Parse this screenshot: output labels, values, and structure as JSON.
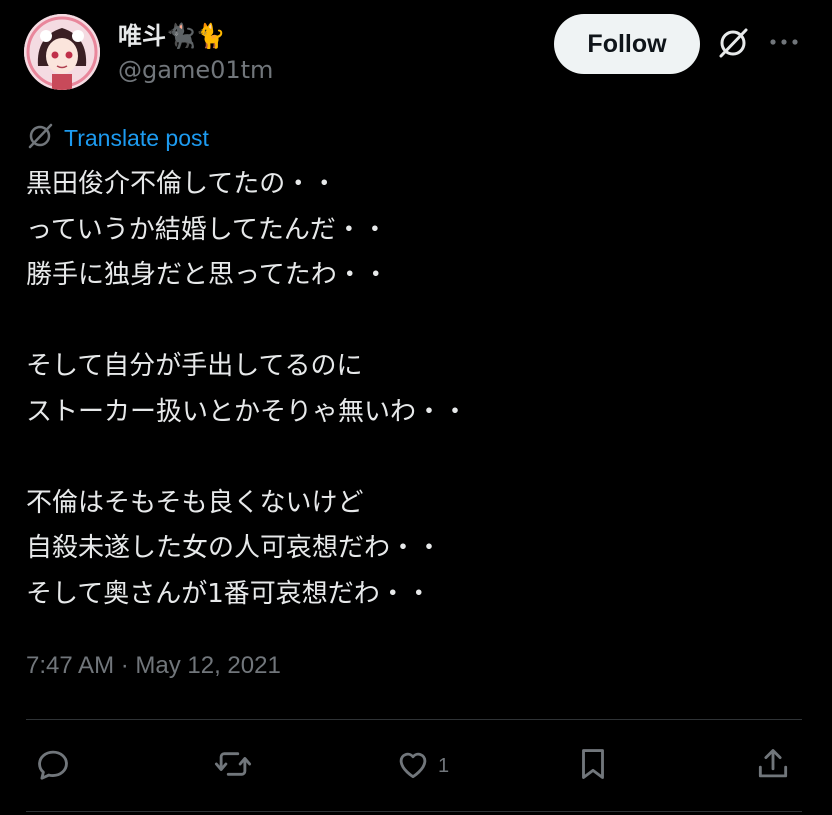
{
  "author": {
    "display_name": "唯斗🐈‍⬛🐈",
    "handle": "@game01tm"
  },
  "header": {
    "follow_label": "Follow"
  },
  "translate": {
    "label": "Translate post"
  },
  "tweet": {
    "lines": [
      "黒田俊介不倫してたの・・",
      "っていうか結婚してたんだ・・",
      "勝手に独身だと思ってたわ・・",
      "",
      "そして自分が手出してるのに",
      "ストーカー扱いとかそりゃ無いわ・・",
      "",
      "不倫はそもそも良くないけど",
      "自殺未遂した女の人可哀想だわ・・",
      "そして奥さんが1番可哀想だわ・・"
    ],
    "timestamp": "7:47 AM · May 12, 2021"
  },
  "actions": {
    "like_count": "1"
  },
  "colors": {
    "background": "#000000",
    "text": "#e7e9ea",
    "secondary": "#71767b",
    "link": "#1d9bf0",
    "divider": "#2f3336"
  },
  "icons": [
    "grok-icon",
    "more-icon",
    "translate-icon",
    "reply-icon",
    "retweet-icon",
    "like-icon",
    "bookmark-icon",
    "share-icon"
  ]
}
